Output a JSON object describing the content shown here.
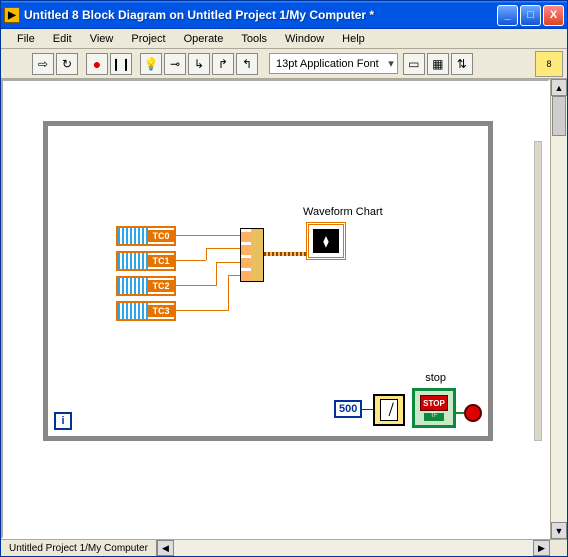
{
  "window": {
    "title": "Untitled 8 Block Diagram on Untitled Project 1/My Computer *",
    "min": "_",
    "max": "□",
    "close": "X"
  },
  "menu": {
    "file": "File",
    "edit": "Edit",
    "view": "View",
    "project": "Project",
    "operate": "Operate",
    "tools": "Tools",
    "window": "Window",
    "help": "Help"
  },
  "toolbar": {
    "run": "⇨",
    "run_cont": "↻",
    "record": "●",
    "pause": "❙❙",
    "bulb": "💡",
    "probe": "⊸",
    "step_in": "↳",
    "step_over": "↱",
    "step_out": "↰",
    "font": "13pt Application Font",
    "align": "▭",
    "dist": "▦",
    "reorder": "⇅",
    "lv_badge": "8"
  },
  "diagram": {
    "tc": [
      "TC0",
      "TC1",
      "TC2",
      "TC3"
    ],
    "chart_label": "Waveform Chart",
    "chart_glyph": "⧫",
    "wait_const": "500",
    "stop_label": "stop",
    "stop_text": "STOP",
    "tf": "TF",
    "loop_i": "i"
  },
  "statusbar": {
    "path": "Untitled Project 1/My Computer"
  },
  "scroll": {
    "up": "▲",
    "down": "▼",
    "left": "◀",
    "right": "▶"
  }
}
